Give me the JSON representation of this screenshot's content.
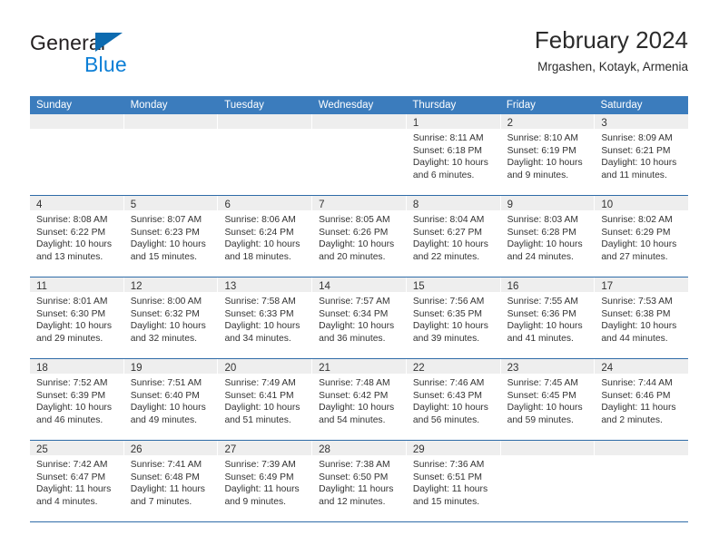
{
  "brand": {
    "name_top": "General",
    "name_bottom": "Blue",
    "color_dark": "#231f20",
    "color_blue": "#0d7fd6"
  },
  "header": {
    "title": "February 2024",
    "subtitle": "Mrgashen, Kotayk, Armenia"
  },
  "theme": {
    "header_bg": "#3b7cbd",
    "row_divider": "#2f6ca8",
    "day_band_bg": "#eeeeee"
  },
  "weekdays": [
    "Sunday",
    "Monday",
    "Tuesday",
    "Wednesday",
    "Thursday",
    "Friday",
    "Saturday"
  ],
  "weeks": [
    [
      {
        "day": "",
        "lines": []
      },
      {
        "day": "",
        "lines": []
      },
      {
        "day": "",
        "lines": []
      },
      {
        "day": "",
        "lines": []
      },
      {
        "day": "1",
        "lines": [
          "Sunrise: 8:11 AM",
          "Sunset: 6:18 PM",
          "Daylight: 10 hours",
          "and 6 minutes."
        ]
      },
      {
        "day": "2",
        "lines": [
          "Sunrise: 8:10 AM",
          "Sunset: 6:19 PM",
          "Daylight: 10 hours",
          "and 9 minutes."
        ]
      },
      {
        "day": "3",
        "lines": [
          "Sunrise: 8:09 AM",
          "Sunset: 6:21 PM",
          "Daylight: 10 hours",
          "and 11 minutes."
        ]
      }
    ],
    [
      {
        "day": "4",
        "lines": [
          "Sunrise: 8:08 AM",
          "Sunset: 6:22 PM",
          "Daylight: 10 hours",
          "and 13 minutes."
        ]
      },
      {
        "day": "5",
        "lines": [
          "Sunrise: 8:07 AM",
          "Sunset: 6:23 PM",
          "Daylight: 10 hours",
          "and 15 minutes."
        ]
      },
      {
        "day": "6",
        "lines": [
          "Sunrise: 8:06 AM",
          "Sunset: 6:24 PM",
          "Daylight: 10 hours",
          "and 18 minutes."
        ]
      },
      {
        "day": "7",
        "lines": [
          "Sunrise: 8:05 AM",
          "Sunset: 6:26 PM",
          "Daylight: 10 hours",
          "and 20 minutes."
        ]
      },
      {
        "day": "8",
        "lines": [
          "Sunrise: 8:04 AM",
          "Sunset: 6:27 PM",
          "Daylight: 10 hours",
          "and 22 minutes."
        ]
      },
      {
        "day": "9",
        "lines": [
          "Sunrise: 8:03 AM",
          "Sunset: 6:28 PM",
          "Daylight: 10 hours",
          "and 24 minutes."
        ]
      },
      {
        "day": "10",
        "lines": [
          "Sunrise: 8:02 AM",
          "Sunset: 6:29 PM",
          "Daylight: 10 hours",
          "and 27 minutes."
        ]
      }
    ],
    [
      {
        "day": "11",
        "lines": [
          "Sunrise: 8:01 AM",
          "Sunset: 6:30 PM",
          "Daylight: 10 hours",
          "and 29 minutes."
        ]
      },
      {
        "day": "12",
        "lines": [
          "Sunrise: 8:00 AM",
          "Sunset: 6:32 PM",
          "Daylight: 10 hours",
          "and 32 minutes."
        ]
      },
      {
        "day": "13",
        "lines": [
          "Sunrise: 7:58 AM",
          "Sunset: 6:33 PM",
          "Daylight: 10 hours",
          "and 34 minutes."
        ]
      },
      {
        "day": "14",
        "lines": [
          "Sunrise: 7:57 AM",
          "Sunset: 6:34 PM",
          "Daylight: 10 hours",
          "and 36 minutes."
        ]
      },
      {
        "day": "15",
        "lines": [
          "Sunrise: 7:56 AM",
          "Sunset: 6:35 PM",
          "Daylight: 10 hours",
          "and 39 minutes."
        ]
      },
      {
        "day": "16",
        "lines": [
          "Sunrise: 7:55 AM",
          "Sunset: 6:36 PM",
          "Daylight: 10 hours",
          "and 41 minutes."
        ]
      },
      {
        "day": "17",
        "lines": [
          "Sunrise: 7:53 AM",
          "Sunset: 6:38 PM",
          "Daylight: 10 hours",
          "and 44 minutes."
        ]
      }
    ],
    [
      {
        "day": "18",
        "lines": [
          "Sunrise: 7:52 AM",
          "Sunset: 6:39 PM",
          "Daylight: 10 hours",
          "and 46 minutes."
        ]
      },
      {
        "day": "19",
        "lines": [
          "Sunrise: 7:51 AM",
          "Sunset: 6:40 PM",
          "Daylight: 10 hours",
          "and 49 minutes."
        ]
      },
      {
        "day": "20",
        "lines": [
          "Sunrise: 7:49 AM",
          "Sunset: 6:41 PM",
          "Daylight: 10 hours",
          "and 51 minutes."
        ]
      },
      {
        "day": "21",
        "lines": [
          "Sunrise: 7:48 AM",
          "Sunset: 6:42 PM",
          "Daylight: 10 hours",
          "and 54 minutes."
        ]
      },
      {
        "day": "22",
        "lines": [
          "Sunrise: 7:46 AM",
          "Sunset: 6:43 PM",
          "Daylight: 10 hours",
          "and 56 minutes."
        ]
      },
      {
        "day": "23",
        "lines": [
          "Sunrise: 7:45 AM",
          "Sunset: 6:45 PM",
          "Daylight: 10 hours",
          "and 59 minutes."
        ]
      },
      {
        "day": "24",
        "lines": [
          "Sunrise: 7:44 AM",
          "Sunset: 6:46 PM",
          "Daylight: 11 hours",
          "and 2 minutes."
        ]
      }
    ],
    [
      {
        "day": "25",
        "lines": [
          "Sunrise: 7:42 AM",
          "Sunset: 6:47 PM",
          "Daylight: 11 hours",
          "and 4 minutes."
        ]
      },
      {
        "day": "26",
        "lines": [
          "Sunrise: 7:41 AM",
          "Sunset: 6:48 PM",
          "Daylight: 11 hours",
          "and 7 minutes."
        ]
      },
      {
        "day": "27",
        "lines": [
          "Sunrise: 7:39 AM",
          "Sunset: 6:49 PM",
          "Daylight: 11 hours",
          "and 9 minutes."
        ]
      },
      {
        "day": "28",
        "lines": [
          "Sunrise: 7:38 AM",
          "Sunset: 6:50 PM",
          "Daylight: 11 hours",
          "and 12 minutes."
        ]
      },
      {
        "day": "29",
        "lines": [
          "Sunrise: 7:36 AM",
          "Sunset: 6:51 PM",
          "Daylight: 11 hours",
          "and 15 minutes."
        ]
      },
      {
        "day": "",
        "lines": []
      },
      {
        "day": "",
        "lines": []
      }
    ]
  ]
}
